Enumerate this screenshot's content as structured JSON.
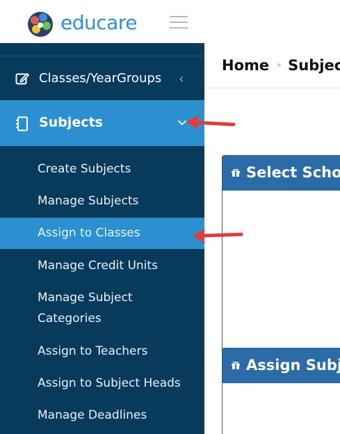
{
  "app": {
    "brand": "educare",
    "brand_color": "#2f8fcf"
  },
  "sidebar": {
    "items": [
      {
        "label": "Classes/YearGroups",
        "icon": "edit-icon",
        "expanded": false
      },
      {
        "label": "Subjects",
        "icon": "notebook-icon",
        "expanded": true,
        "active": true
      }
    ],
    "submenu": [
      {
        "label": "Create Subjects"
      },
      {
        "label": "Manage Subjects"
      },
      {
        "label": "Assign to Classes",
        "active": true
      },
      {
        "label": "Manage Credit Units"
      },
      {
        "label": "Manage Subject"
      },
      {
        "label": "Categories"
      },
      {
        "label": "Assign to Teachers"
      },
      {
        "label": "Assign to Subject Heads"
      },
      {
        "label": "Manage Deadlines"
      }
    ]
  },
  "breadcrumb": {
    "home": "Home",
    "current": "Subjec"
  },
  "cards": [
    {
      "title": "Select Scho",
      "icon": "gift-icon"
    },
    {
      "title": "Assign Subj",
      "icon": "gift-icon"
    }
  ],
  "colors": {
    "sidebar_bg": "#083a5c",
    "active_bg": "#2b8fd0",
    "card_header": "#2a6ba8",
    "annotation_arrow": "#e23b3b"
  }
}
